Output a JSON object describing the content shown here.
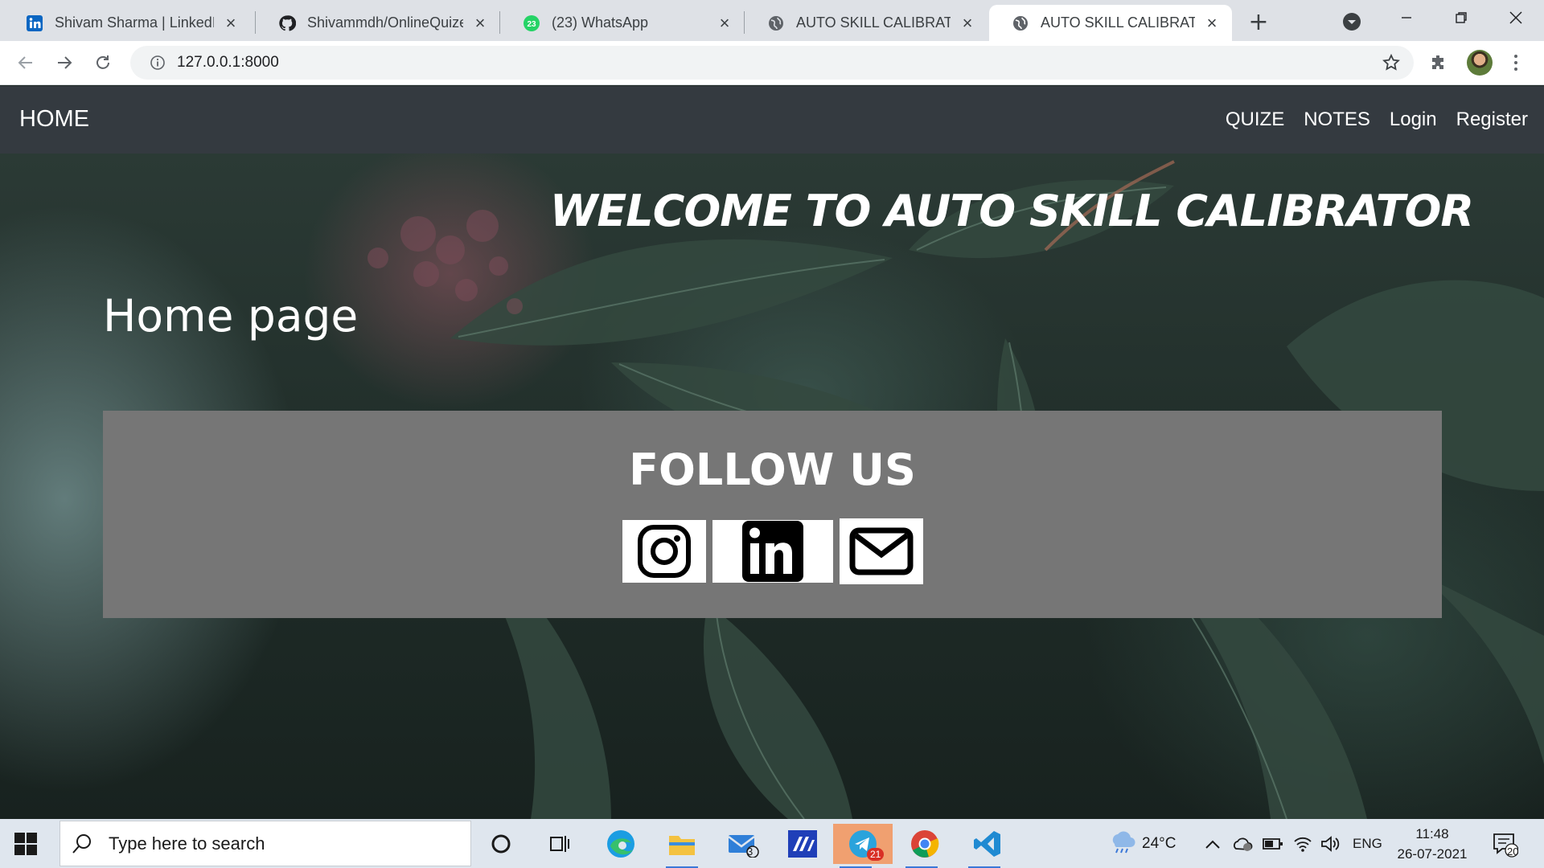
{
  "browser": {
    "tabs": [
      {
        "title": "Shivam Sharma | LinkedIn",
        "favicon": "linkedin-icon",
        "active": false
      },
      {
        "title": "Shivammdh/OnlineQuizeS",
        "favicon": "github-icon",
        "active": false
      },
      {
        "title": "(23) WhatsApp",
        "favicon": "whatsapp-icon",
        "badge": "23",
        "active": false
      },
      {
        "title": "AUTO SKILL CALIBRATOR",
        "favicon": "globe-icon",
        "active": false
      },
      {
        "title": "AUTO SKILL CALIBRATOR",
        "favicon": "globe-icon",
        "active": true
      }
    ],
    "new_tab": "+",
    "address": "127.0.0.1:8000"
  },
  "site": {
    "brand": "HOME",
    "nav": [
      "QUIZE",
      "NOTES",
      "Login",
      "Register"
    ],
    "welcome": "WELCOME TO AUTO SKILL CALIBRATOR",
    "subtitle": "Home page",
    "follow": {
      "title": "FOLLOW US",
      "links": [
        "instagram-icon",
        "linkedin-icon",
        "mail-icon"
      ]
    }
  },
  "taskbar": {
    "search_placeholder": "Type here to search",
    "pinned": [
      "cortana-icon",
      "task-view-icon",
      "edge-icon",
      "file-explorer-icon",
      "mail-icon",
      "app-icon",
      "telegram-icon",
      "chrome-icon",
      "vscode-icon"
    ],
    "mail_badge": "3",
    "telegram_badge": "21",
    "weather": "24°C",
    "language": "ENG",
    "time": "11:48",
    "date": "26-07-2021",
    "notifications": "20"
  },
  "colors": {
    "navbar": "#343a40",
    "follow_panel": "#767676",
    "tab_strip": "#dee1e6"
  }
}
